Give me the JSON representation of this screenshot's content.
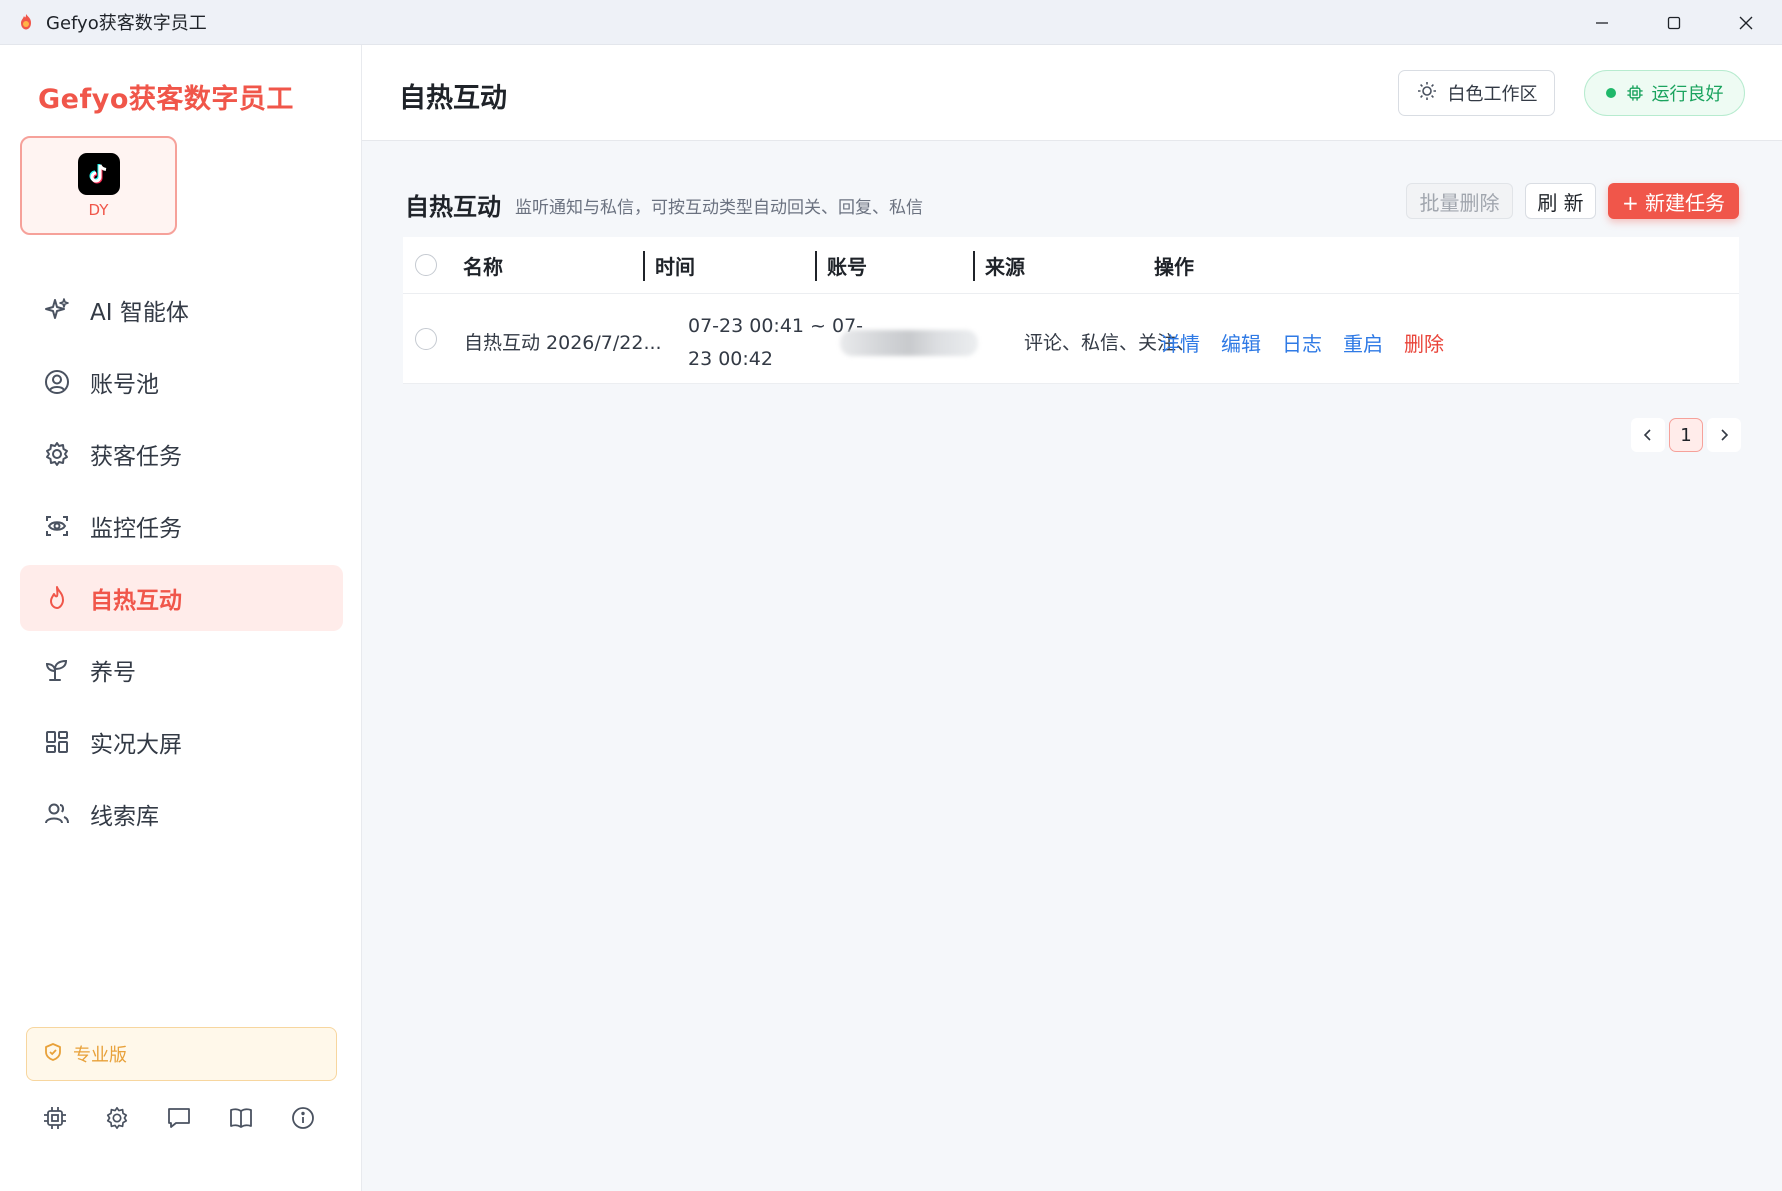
{
  "window": {
    "title": "Gefyo获客数字员工"
  },
  "sidebar": {
    "brand": "Gefyo获客数字员工",
    "platform": {
      "label": "DY",
      "icon": "tiktok-icon"
    },
    "items": [
      {
        "label": "AI 智能体",
        "icon": "sparkle-icon",
        "active": false
      },
      {
        "label": "账号池",
        "icon": "user-circle-icon",
        "active": false
      },
      {
        "label": "获客任务",
        "icon": "gear-icon",
        "active": false
      },
      {
        "label": "监控任务",
        "icon": "scan-eye-icon",
        "active": false
      },
      {
        "label": "自热互动",
        "icon": "flame-icon",
        "active": true
      },
      {
        "label": "养号",
        "icon": "sprout-icon",
        "active": false
      },
      {
        "label": "实况大屏",
        "icon": "grid-icon",
        "active": false
      },
      {
        "label": "线索库",
        "icon": "users-icon",
        "active": false
      }
    ],
    "edition": "专业版",
    "bottom_icons": [
      "chip-icon",
      "gear-icon",
      "message-icon",
      "book-icon",
      "info-icon"
    ]
  },
  "header": {
    "title": "自热互动",
    "theme_button": "白色工作区",
    "status": "运行良好"
  },
  "section": {
    "title": "自热互动",
    "description": "监听通知与私信，可按互动类型自动回关、回复、私信",
    "batch_delete": "批量删除",
    "refresh": "刷 新",
    "new_task": "+ 新建任务"
  },
  "table": {
    "columns": [
      "名称",
      "时间",
      "账号",
      "来源",
      "操作"
    ],
    "rows": [
      {
        "name": "自热互动 2026/7/22...",
        "time_line1": "07-23 00:41 ~ 07-",
        "time_line2": "23 00:42",
        "source": "评论、私信、关注、",
        "actions": [
          "详情",
          "编辑",
          "日志",
          "重启",
          "删除"
        ]
      }
    ]
  },
  "pagination": {
    "current": "1"
  },
  "colors": {
    "accent": "#f0564a",
    "link": "#2f7ae5",
    "danger": "#e9443a",
    "success": "#1fb86a",
    "pro": "#e8a13a"
  }
}
